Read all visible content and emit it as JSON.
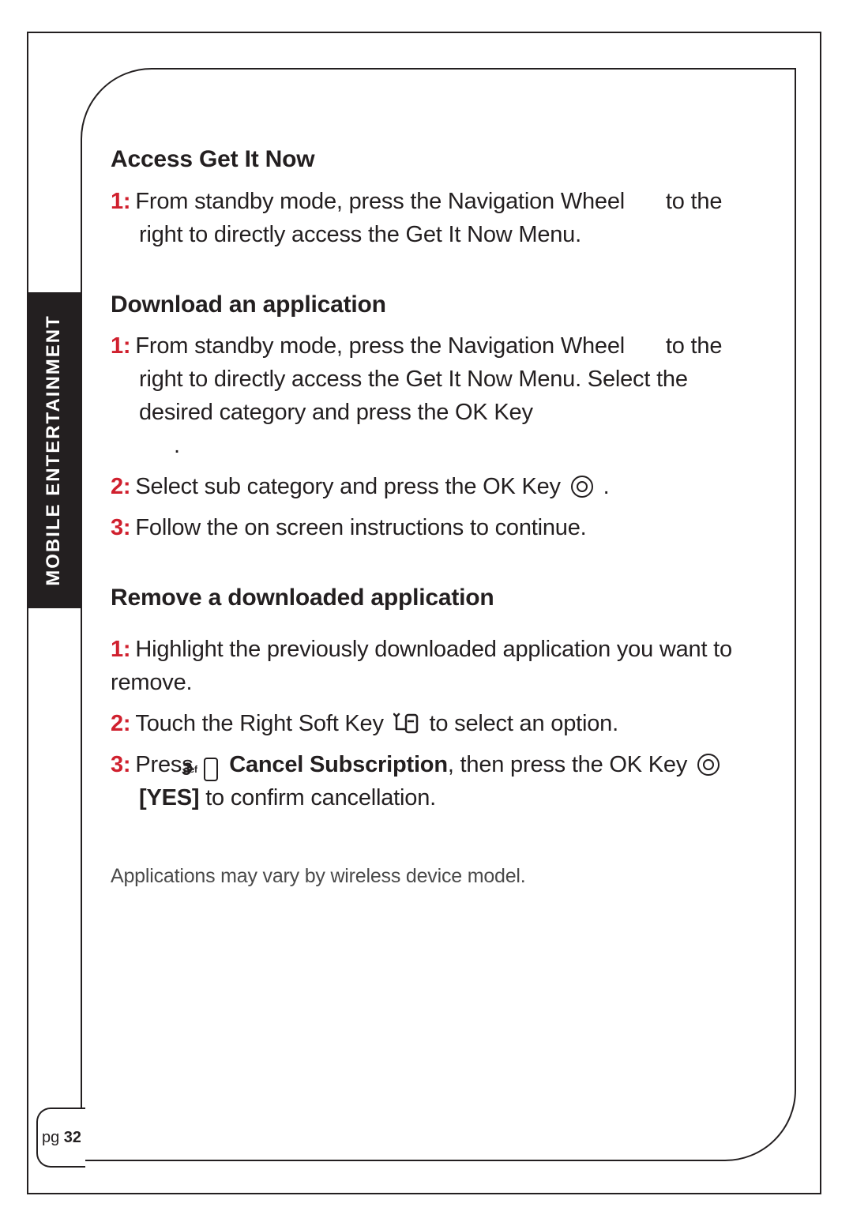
{
  "side_tab": "MOBILE ENTERTAINMENT",
  "page_label_prefix": "pg ",
  "page_number": "32",
  "sections": {
    "s1": {
      "heading": "Access Get It Now",
      "step1_num": "1:",
      "step1_a": "From standby mode, press the Navigation Wheel",
      "step1_b": "to the right to directly access the Get It Now Menu."
    },
    "s2": {
      "heading": "Download an application",
      "step1_num": "1:",
      "step1_a": "From standby mode, press the Navigation Wheel",
      "step1_b": "to the right to directly access the Get It Now Menu. Select the desired category and press the OK Key",
      "step1_period": ".",
      "step2_num": "2:",
      "step2_a": "Select sub category and press the OK Key",
      "step2_period": ".",
      "step3_num": "3:",
      "step3": "Follow the on screen instructions to continue."
    },
    "s3": {
      "heading": "Remove a downloaded application",
      "step1_num": "1:",
      "step1": "Highlight the previously downloaded application you want to remove.",
      "step2_num": "2:",
      "step2_a": "Touch the Right Soft Key",
      "step2_b": "to select an option.",
      "step3_num": "3:",
      "step3_a": "Press",
      "step3_b": "Cancel Subscription",
      "step3_c": ", then press the OK Key",
      "step3_d": "[YES]",
      "step3_e": " to confirm cancellation.",
      "key3_digit": "3",
      "key3_def": "def"
    }
  },
  "footnote": "Applications may vary by wireless device model."
}
